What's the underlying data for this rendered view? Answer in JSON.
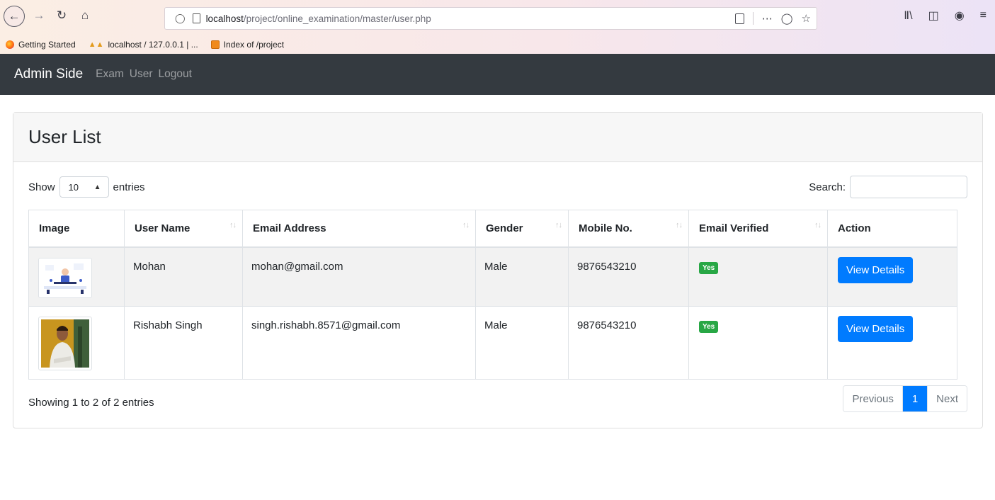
{
  "browser": {
    "url_host": "localhost",
    "url_path": "/project/online_examination/master/user.php",
    "bookmarks": [
      {
        "label": "Getting Started"
      },
      {
        "label": "localhost / 127.0.0.1 | ..."
      },
      {
        "label": "Index of /project"
      }
    ]
  },
  "navbar": {
    "brand": "Admin Side",
    "links": [
      "Exam",
      "User",
      "Logout"
    ]
  },
  "card": {
    "title": "User List",
    "show_label": "Show",
    "entries_label": "entries",
    "length_value": "10",
    "search_label": "Search:",
    "search_value": "",
    "columns": [
      "Image",
      "User Name",
      "Email Address",
      "Gender",
      "Mobile No.",
      "Email Verified",
      "Action"
    ],
    "rows": [
      {
        "user_name": "Mohan",
        "email": "mohan@gmail.com",
        "gender": "Male",
        "mobile": "9876543210",
        "verified": "Yes",
        "action": "View Details"
      },
      {
        "user_name": "Rishabh Singh",
        "email": "singh.rishabh.8571@gmail.com",
        "gender": "Male",
        "mobile": "9876543210",
        "verified": "Yes",
        "action": "View Details"
      }
    ],
    "info": "Showing 1 to 2 of 2 entries",
    "pagination": {
      "previous": "Previous",
      "current": "1",
      "next": "Next"
    }
  },
  "colors": {
    "navbar_bg": "#343a40",
    "primary": "#007bff",
    "success": "#28a745"
  }
}
